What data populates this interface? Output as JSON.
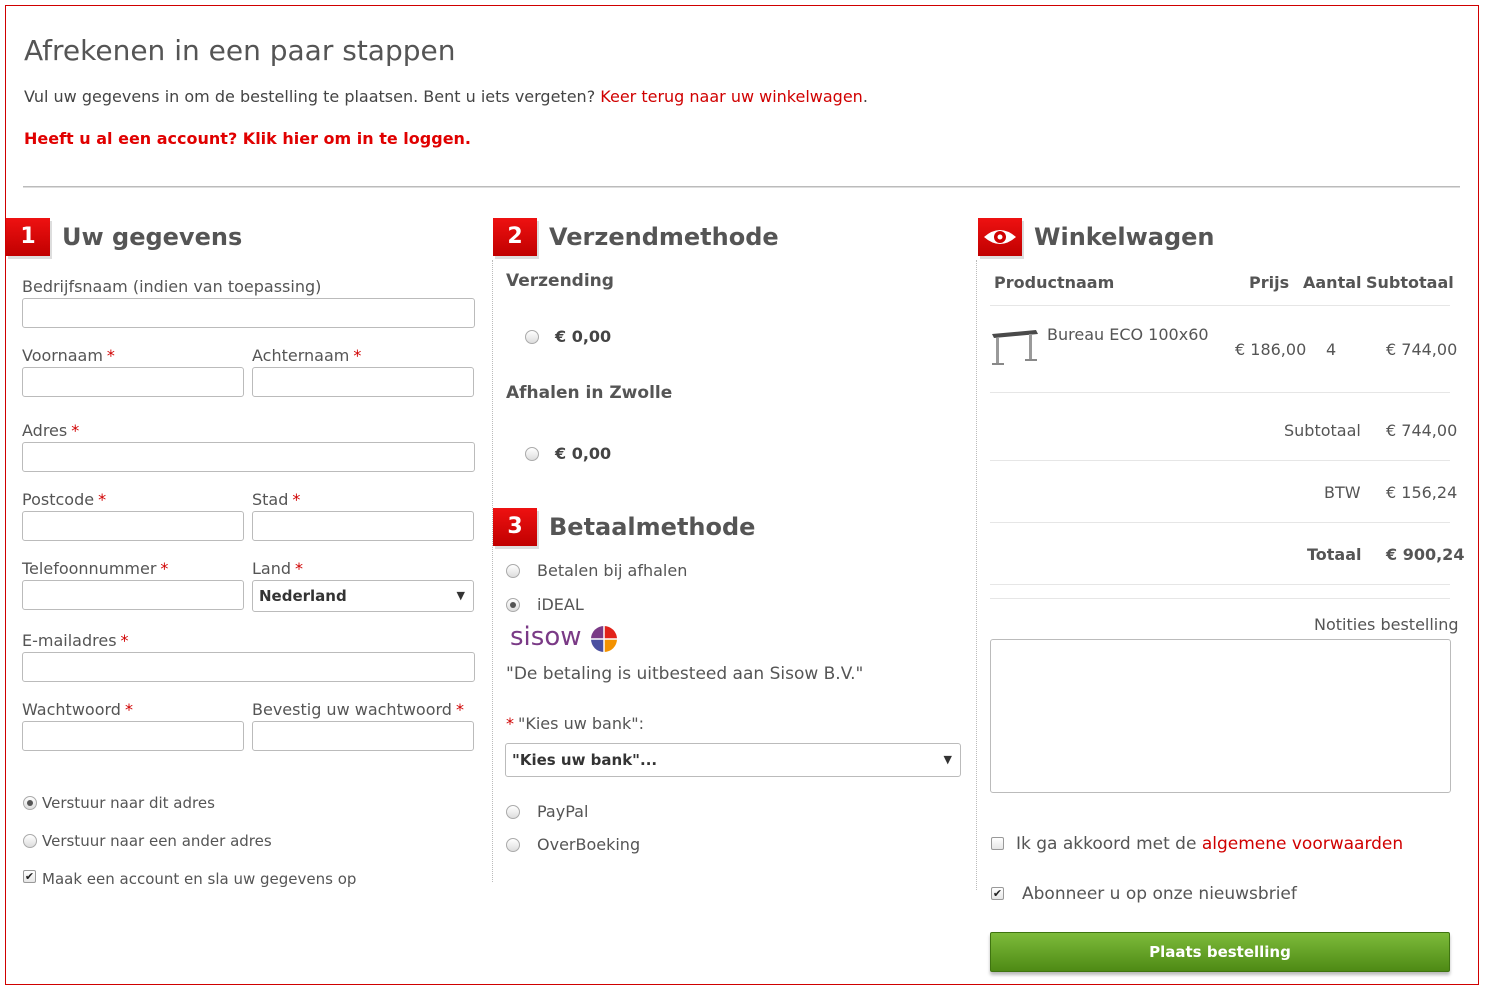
{
  "header": {
    "title": "Afrekenen in een paar stappen",
    "intro_text": "Vul uw gegevens in om de bestelling te plaatsen. Bent u iets vergeten?",
    "intro_link": "Keer terug naar uw winkelwagen",
    "intro_end": ".",
    "login_link": "Heeft u al een account? Klik hier om in te loggen."
  },
  "step1": {
    "number": "1",
    "title": "Uw gegevens",
    "required_mark": "*",
    "fields": {
      "company": "Bedrijfsnaam (indien van toepassing)",
      "firstname": "Voornaam",
      "lastname": "Achternaam",
      "address": "Adres",
      "postcode": "Postcode",
      "city": "Stad",
      "phone": "Telefoonnummer",
      "country": "Land",
      "country_value": "Nederland",
      "email": "E-mailadres",
      "password": "Wachtwoord",
      "password_confirm": "Bevestig uw wachtwoord"
    },
    "ship_same": "Verstuur naar dit adres",
    "ship_other": "Verstuur naar een ander adres",
    "create_account": "Maak een account en sla uw gegevens op"
  },
  "step2": {
    "number": "2",
    "title": "Verzendmethode",
    "methods": [
      {
        "name": "Verzending",
        "price": "€ 0,00"
      },
      {
        "name": "Afhalen in Zwolle",
        "price": "€ 0,00"
      }
    ]
  },
  "step3": {
    "number": "3",
    "title": "Betaalmethode",
    "options": {
      "pickup": "Betalen bij afhalen",
      "ideal": "iDEAL",
      "paypal": "PayPal",
      "transfer": "OverBoeking"
    },
    "sisow_logo": "sisow",
    "sisow_note": "\"De betaling is uitbesteed aan Sisow B.V.\"",
    "bank_label": "\"Kies uw bank\":",
    "bank_value": "\"Kies uw bank\"..."
  },
  "cart": {
    "title": "Winkelwagen",
    "columns": {
      "product": "Productnaam",
      "price": "Prijs",
      "qty": "Aantal",
      "subtotal": "Subtotaal"
    },
    "items": [
      {
        "name": "Bureau ECO 100x60",
        "price": "€ 186,00",
        "qty": "4",
        "subtotal": "€ 744,00"
      }
    ],
    "totals": {
      "subtotal_label": "Subtotaal",
      "subtotal_value": "€ 744,00",
      "tax_label": "BTW",
      "tax_value": "€ 156,24",
      "total_label": "Totaal",
      "total_value": "€ 900,24"
    },
    "notes_label": "Notities bestelling",
    "terms_text": "Ik ga akkoord met de",
    "terms_link": "algemene voorwaarden",
    "newsletter": "Abonneer u op onze nieuwsbrief",
    "submit": "Plaats bestelling"
  },
  "colors": {
    "accent": "#d00000",
    "button": "#5c9a1f"
  }
}
